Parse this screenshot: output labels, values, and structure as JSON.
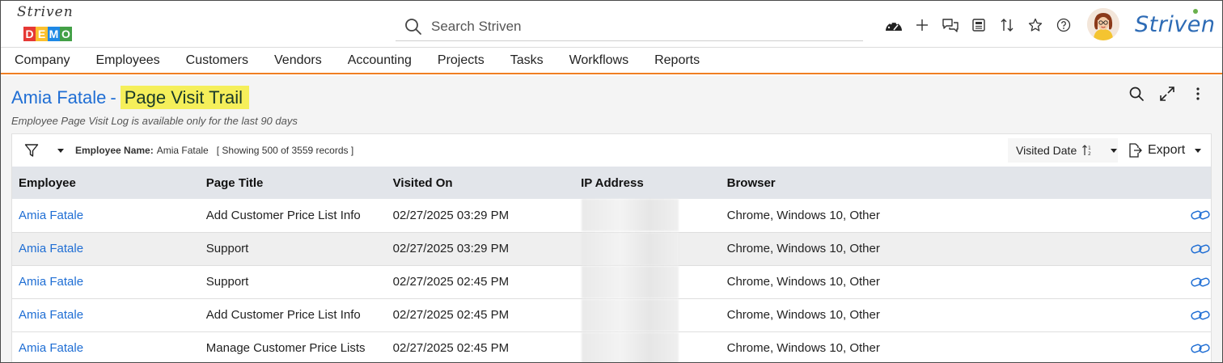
{
  "header": {
    "logo_script": "Striven",
    "logo_demo": [
      "D",
      "E",
      "M",
      "O"
    ],
    "logo_demo_colors": [
      "#e53935",
      "#fbc02d",
      "#1e88e5",
      "#43a047"
    ],
    "search_placeholder": "Search Striven",
    "brand": "Striven",
    "tool_icons": [
      "dashboard-icon",
      "plus-icon",
      "chat-icon",
      "news-icon",
      "sort-arrows-icon",
      "star-icon",
      "help-icon"
    ]
  },
  "nav": {
    "items": [
      "Company",
      "Employees",
      "Customers",
      "Vendors",
      "Accounting",
      "Projects",
      "Tasks",
      "Workflows",
      "Reports"
    ]
  },
  "page": {
    "title_name": "Amia Fatale",
    "title_sep": "-",
    "title_highlight": "Page Visit Trail",
    "subtitle": "Employee Page Visit Log is available only for the last 90 days"
  },
  "toolbar": {
    "filter_label": "Employee Name:",
    "filter_value": "Amia Fatale",
    "records": "[ Showing 500 of 3559 records ]",
    "sort_label": "Visited Date",
    "export_label": "Export"
  },
  "table": {
    "columns": [
      "Employee",
      "Page Title",
      "Visited On",
      "IP Address",
      "Browser"
    ],
    "rows": [
      {
        "employee": "Amia Fatale",
        "page": "Add Customer Price List Info",
        "visited": "02/27/2025 03:29 PM",
        "browser": "Chrome, Windows 10, Other"
      },
      {
        "employee": "Amia Fatale",
        "page": "Support",
        "visited": "02/27/2025 03:29 PM",
        "browser": "Chrome, Windows 10, Other"
      },
      {
        "employee": "Amia Fatale",
        "page": "Support",
        "visited": "02/27/2025 02:45 PM",
        "browser": "Chrome, Windows 10, Other"
      },
      {
        "employee": "Amia Fatale",
        "page": "Add Customer Price List Info",
        "visited": "02/27/2025 02:45 PM",
        "browser": "Chrome, Windows 10, Other"
      },
      {
        "employee": "Amia Fatale",
        "page": "Manage Customer Price Lists",
        "visited": "02/27/2025 02:45 PM",
        "browser": "Chrome, Windows 10, Other"
      }
    ]
  },
  "colors": {
    "accent_orange": "#f07f22",
    "link_blue": "#1f6ed4",
    "highlight_yellow": "#f5ef5a"
  }
}
